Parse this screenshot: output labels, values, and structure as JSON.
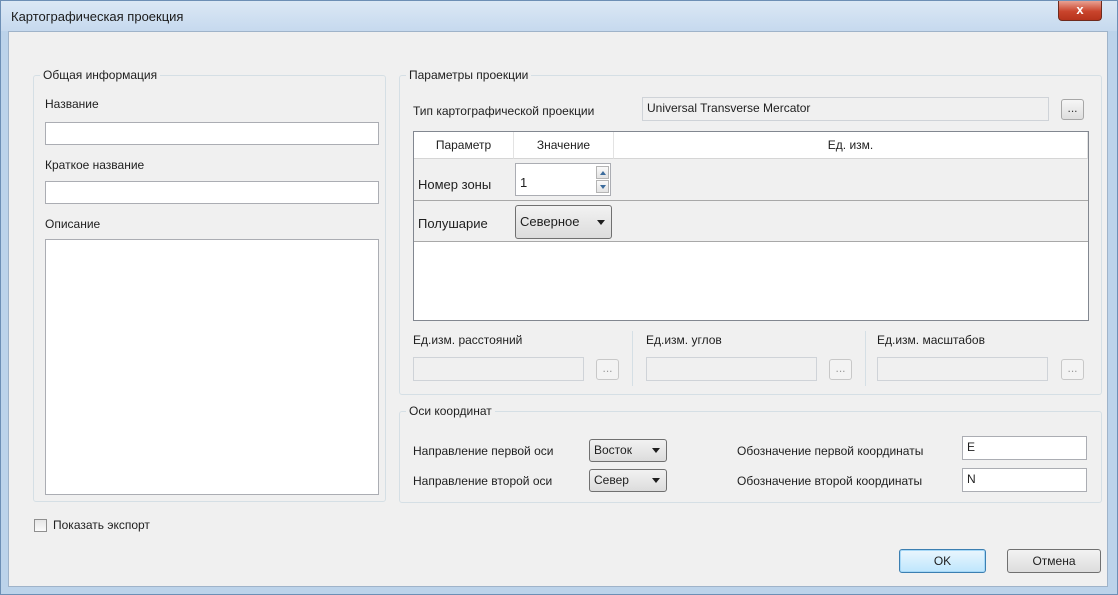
{
  "window": {
    "title": "Картографическая проекция",
    "close_label": "x"
  },
  "general": {
    "group_title": "Общая информация",
    "name_label": "Название",
    "name_value": "",
    "short_name_label": "Краткое название",
    "short_name_value": "",
    "description_label": "Описание",
    "description_value": ""
  },
  "projection": {
    "group_title": "Параметры проекции",
    "type_label": "Тип картографической проекции",
    "type_value": "Universal Transverse Mercator",
    "type_button": "...",
    "table": {
      "headers": [
        "Параметр",
        "Значение",
        "Ед. изм."
      ],
      "rows": [
        {
          "param": "Номер зоны",
          "value": "1",
          "unit": ""
        },
        {
          "param": "Полушарие",
          "value": "Северное",
          "unit": ""
        }
      ]
    },
    "units": [
      {
        "label": "Ед.изм. расстояний",
        "value": "",
        "button": "..."
      },
      {
        "label": "Ед.изм. углов",
        "value": "",
        "button": "..."
      },
      {
        "label": "Ед.изм. масштабов",
        "value": "",
        "button": "..."
      }
    ]
  },
  "axes": {
    "group_title": "Оси координат",
    "first_dir_label": "Направление первой оси",
    "first_dir_value": "Восток",
    "second_dir_label": "Направление второй оси",
    "second_dir_value": "Север",
    "first_coord_label": "Обозначение первой координаты",
    "first_coord_value": "E",
    "second_coord_label": "Обозначение второй координаты",
    "second_coord_value": "N"
  },
  "footer": {
    "show_export_label": "Показать экспорт",
    "show_export_checked": false,
    "ok_label": "OK",
    "cancel_label": "Отмена"
  },
  "colors": {
    "title_bar": "#c6d9ee",
    "close_button": "#c9442c",
    "dialog_background": "#f0f0f0",
    "default_button_border": "#3c7fb1"
  }
}
